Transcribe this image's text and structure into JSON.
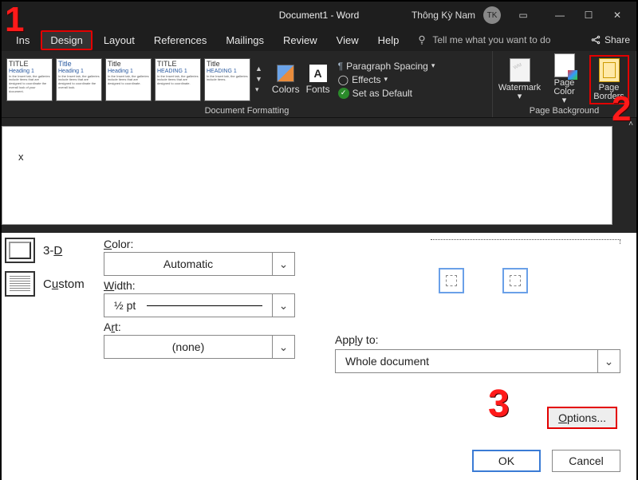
{
  "title": "Document1 - Word",
  "user": {
    "name": "Thông Kỳ Nam",
    "initials": "TK"
  },
  "menu": {
    "insert": "Ins",
    "design": "Design",
    "layout": "Layout",
    "references": "References",
    "mailings": "Mailings",
    "review": "Review",
    "view": "View",
    "help": "Help",
    "tellme": "Tell me what you want to do",
    "share": "Share"
  },
  "ribbon": {
    "doc_formatting": {
      "label": "Document Formatting",
      "thumbs": [
        {
          "title": "TITLE",
          "heading": "Heading 1"
        },
        {
          "title": "Title",
          "heading": "Heading 1"
        },
        {
          "title": "Title",
          "heading": "Heading 1"
        },
        {
          "title": "TITLE",
          "heading": "HEADING 1"
        },
        {
          "title": "Title",
          "heading": "HEADING 1"
        }
      ],
      "colors": "Colors",
      "fonts": "Fonts",
      "paragraph_spacing": "Paragraph Spacing",
      "effects": "Effects",
      "set_default": "Set as Default"
    },
    "page_bg": {
      "label": "Page Background",
      "watermark": "Watermark",
      "page_color": "Page Color",
      "page_borders": "Page Borders"
    }
  },
  "document": {
    "text": "x"
  },
  "dialog": {
    "settings": {
      "threeD": "3-D",
      "custom": "Custom"
    },
    "color": {
      "label": "Color:",
      "value": "Automatic"
    },
    "width": {
      "label": "Width:",
      "value": "½ pt"
    },
    "art": {
      "label": "Art:",
      "value": "(none)"
    },
    "apply": {
      "label": "Apply to:",
      "value": "Whole document"
    },
    "options": "Options...",
    "ok": "OK",
    "cancel": "Cancel"
  },
  "annotations": {
    "one": "1",
    "two": "2",
    "three": "3"
  }
}
